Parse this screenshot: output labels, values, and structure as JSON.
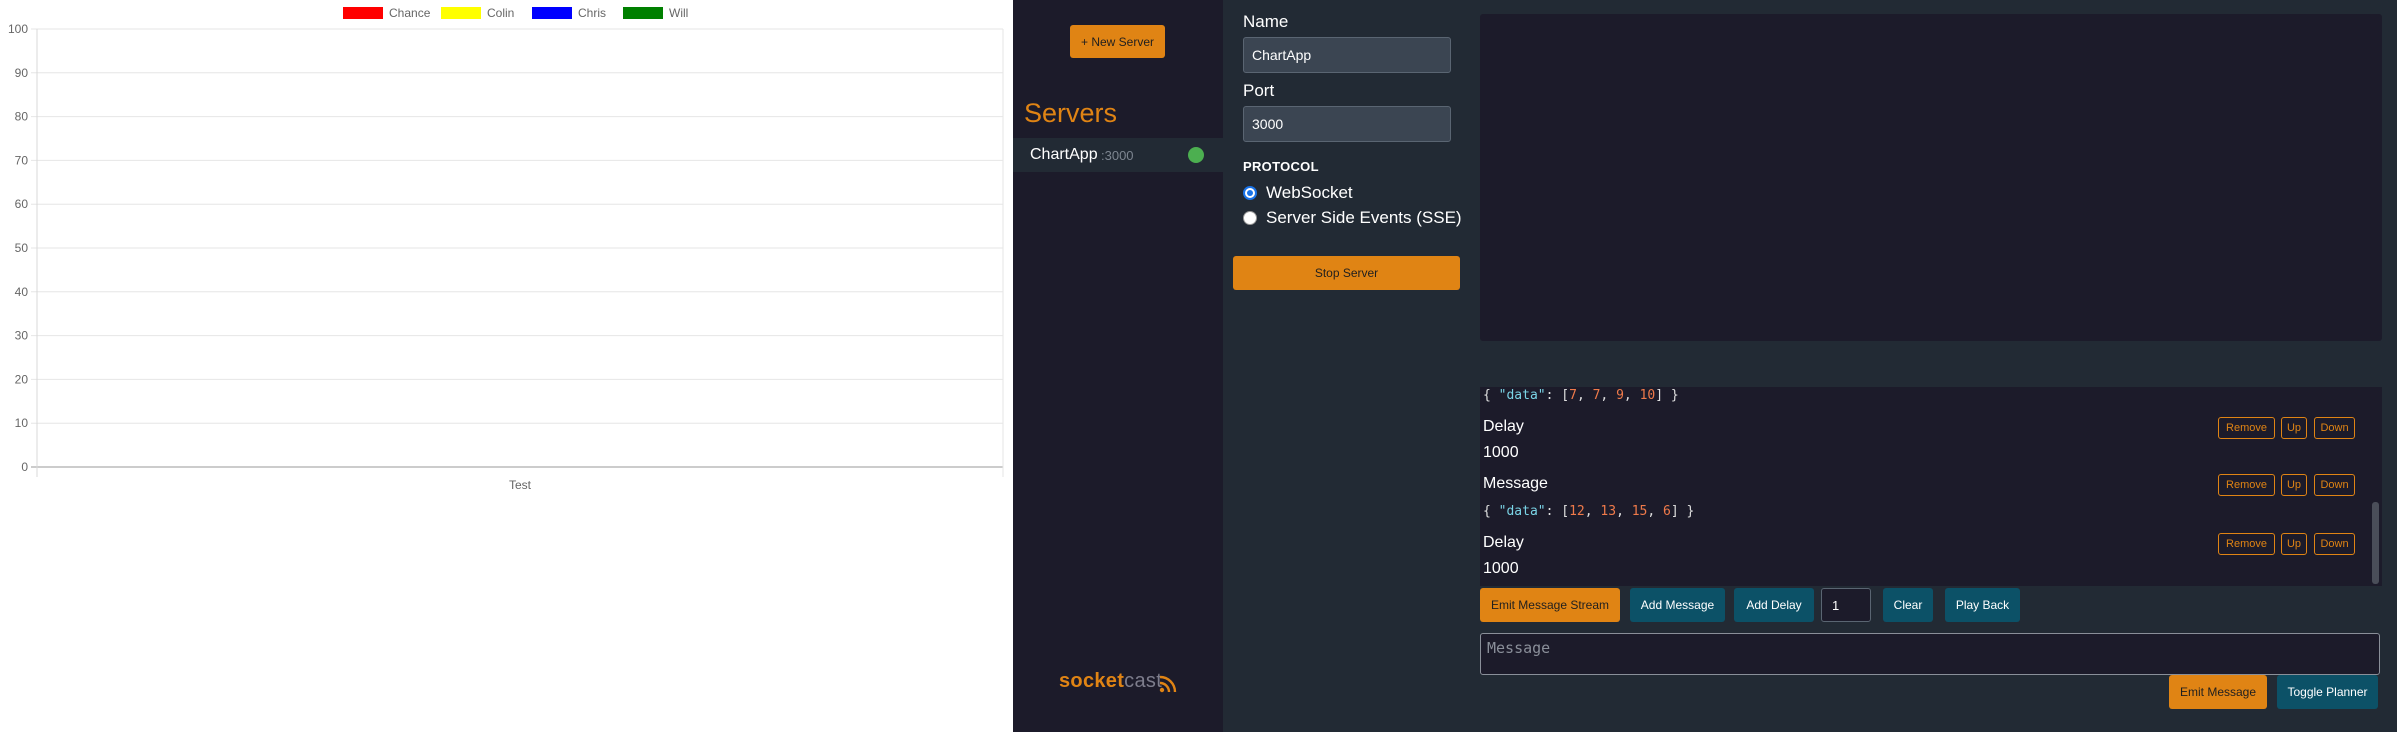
{
  "chart_data": {
    "type": "bar",
    "categories": [
      "Test"
    ],
    "series": [
      {
        "name": "Chance",
        "values": [
          0
        ],
        "color": "#ff0000"
      },
      {
        "name": "Colin",
        "values": [
          0
        ],
        "color": "#ffff00"
      },
      {
        "name": "Chris",
        "values": [
          0
        ],
        "color": "#0000ff"
      },
      {
        "name": "Will",
        "values": [
          0
        ],
        "color": "#008000"
      }
    ],
    "y_ticks": [
      "0",
      "10",
      "20",
      "30",
      "40",
      "50",
      "60",
      "70",
      "80",
      "90",
      "100"
    ],
    "ylim": [
      0,
      100
    ],
    "legend_position": "top-center",
    "grid": true
  },
  "sidebar": {
    "new_server_label": "+ New Server",
    "servers_heading": "Servers",
    "servers": [
      {
        "name": "ChartApp",
        "port": ":3000",
        "status": "running",
        "status_color": "#4caf50"
      }
    ],
    "logo_part1": "socket",
    "logo_part2": "cast",
    "logo_icon": "rss-feed-icon"
  },
  "config": {
    "name_label": "Name",
    "name_value": "ChartApp",
    "port_label": "Port",
    "port_value": "3000",
    "protocol_label": "PROTOCOL",
    "protocols": [
      {
        "label": "WebSocket",
        "selected": true
      },
      {
        "label": "Server Side Events (SSE)",
        "selected": false
      }
    ],
    "stop_label": "Stop Server"
  },
  "planner": {
    "items": [
      {
        "type": "message",
        "code_prefix": "{ ",
        "code_key": "\"data\"",
        "code_mid": ": [",
        "values": [
          "7",
          "7",
          "9",
          "10"
        ],
        "code_suffix": "] }"
      },
      {
        "type": "delay",
        "label": "Delay",
        "value": "1000"
      },
      {
        "type": "message",
        "label": "Message",
        "code_prefix": "{ ",
        "code_key": "\"data\"",
        "code_mid": ": [",
        "values": [
          "12",
          "13",
          "15",
          "6"
        ],
        "code_suffix": "] }"
      },
      {
        "type": "delay",
        "label": "Delay",
        "value": "1000"
      }
    ],
    "remove_label": "Remove",
    "up_label": "Up",
    "down_label": "Down"
  },
  "controls": {
    "emit_stream_label": "Emit Message Stream",
    "add_message_label": "Add Message",
    "add_delay_label": "Add Delay",
    "count_value": "1",
    "clear_label": "Clear",
    "play_back_label": "Play Back"
  },
  "message": {
    "placeholder": "Message",
    "emit_label": "Emit Message",
    "toggle_planner_label": "Toggle Planner"
  },
  "colors": {
    "accent": "#e08414",
    "teal": "#0c5167",
    "panel": "#1c1b2a",
    "background": "#222a34"
  }
}
